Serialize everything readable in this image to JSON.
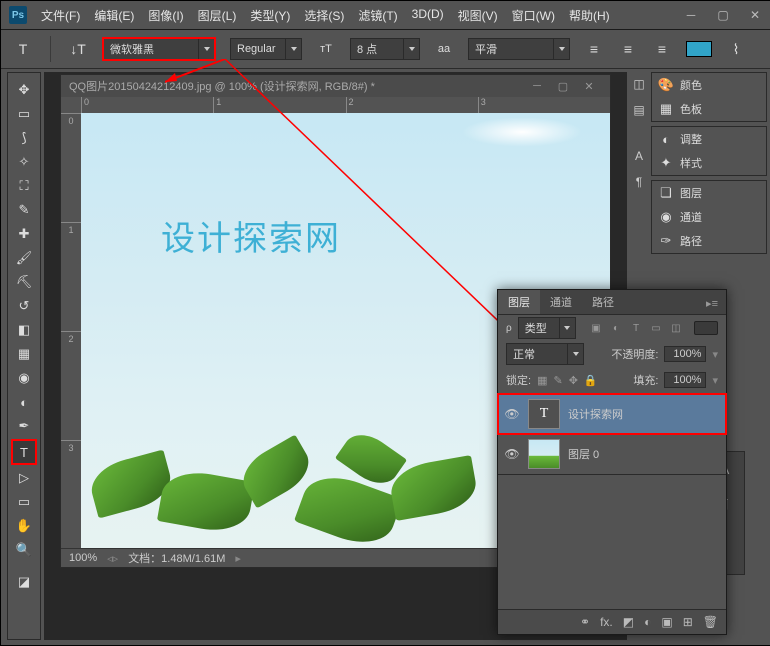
{
  "menu": {
    "file": "文件(F)",
    "edit": "编辑(E)",
    "image": "图像(I)",
    "layer": "图层(L)",
    "type": "类型(Y)",
    "select": "选择(S)",
    "filter": "滤镜(T)",
    "threed": "3D(D)",
    "view": "视图(V)",
    "window": "窗口(W)",
    "help": "帮助(H)"
  },
  "options": {
    "font_family": "微软雅黑",
    "font_weight": "Regular",
    "font_size": "8 点",
    "aa": "aa",
    "anti_alias": "平滑"
  },
  "doc": {
    "title": "QQ图片20150424212409.jpg @ 100% (设计探索网, RGB/8#) *",
    "zoom": "100%",
    "status": "文档：1.48M/1.61M",
    "text_layer": "设计探索网"
  },
  "ruler": {
    "h": [
      "0",
      "1",
      "2",
      "3"
    ],
    "v": [
      "0",
      "1",
      "2",
      "3"
    ]
  },
  "right_dock": {
    "color": "颜色",
    "swatch": "色板",
    "adjust": "调整",
    "style": "样式",
    "layers": "图层",
    "channels": "通道",
    "paths": "路径"
  },
  "layers_panel": {
    "tabs": [
      "图层",
      "通道",
      "路径"
    ],
    "kind_label": "类型",
    "blend_mode": "正常",
    "opacity_label": "不透明度:",
    "opacity": "100%",
    "lock_label": "锁定:",
    "fill_label": "填充:",
    "fill": "100%",
    "layer_text": "设计探索网",
    "layer_bg": "图层 0",
    "fx_label": "fx."
  }
}
